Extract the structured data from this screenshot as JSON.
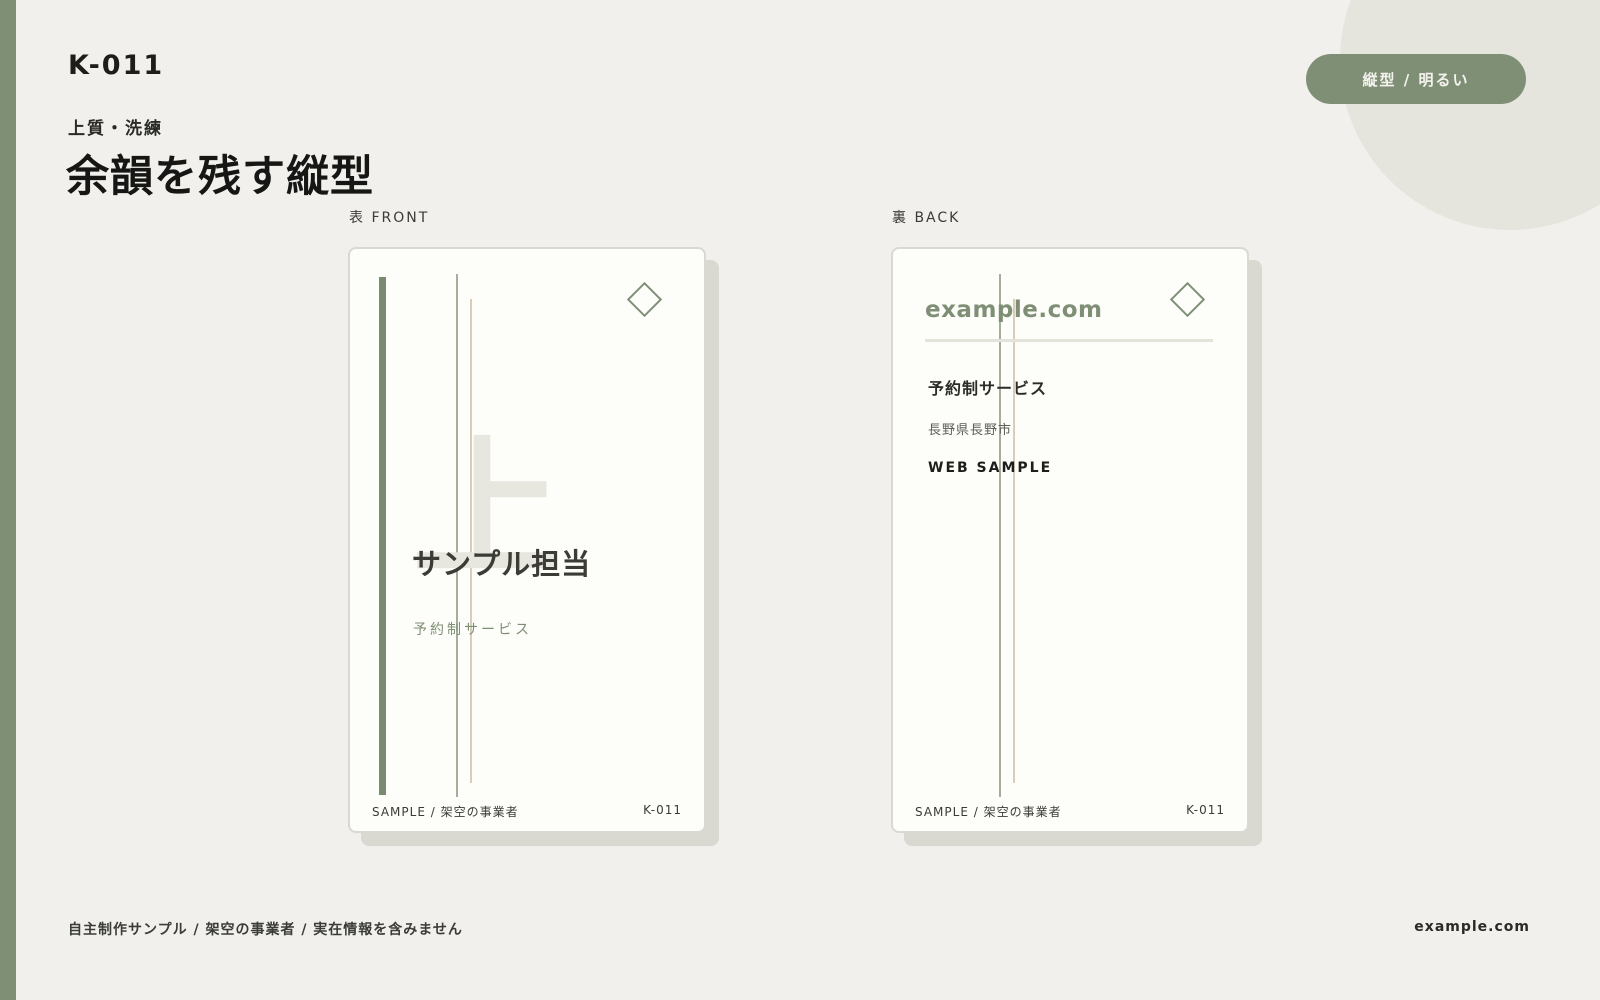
{
  "header": {
    "code": "K-011",
    "tagline": "上質・洗練",
    "title": "余韻を残す縦型",
    "badge": "縦型 / 明るい"
  },
  "front": {
    "label": "表 FRONT",
    "background_glyph": "上",
    "name": "サンプル担当",
    "service": "予約制サービス",
    "footer_left": "SAMPLE / 架空の事業者",
    "footer_right": "K-011"
  },
  "back": {
    "label": "裏 BACK",
    "url": "example.com",
    "service": "予約制サービス",
    "place": "長野県長野市",
    "web": "WEB SAMPLE",
    "footer_left": "SAMPLE / 架空の事業者",
    "footer_right": "K-011"
  },
  "footer": {
    "note": "自主制作サンプル / 架空の事業者 / 実在情報を含みません",
    "url": "example.com"
  },
  "colors": {
    "accent": "#7f8f75",
    "background": "#f1f0ec",
    "card": "#fdfdf9",
    "thin_line": "#d8cdb8"
  },
  "icons": {
    "card_mark": "diamond-outline-icon"
  }
}
